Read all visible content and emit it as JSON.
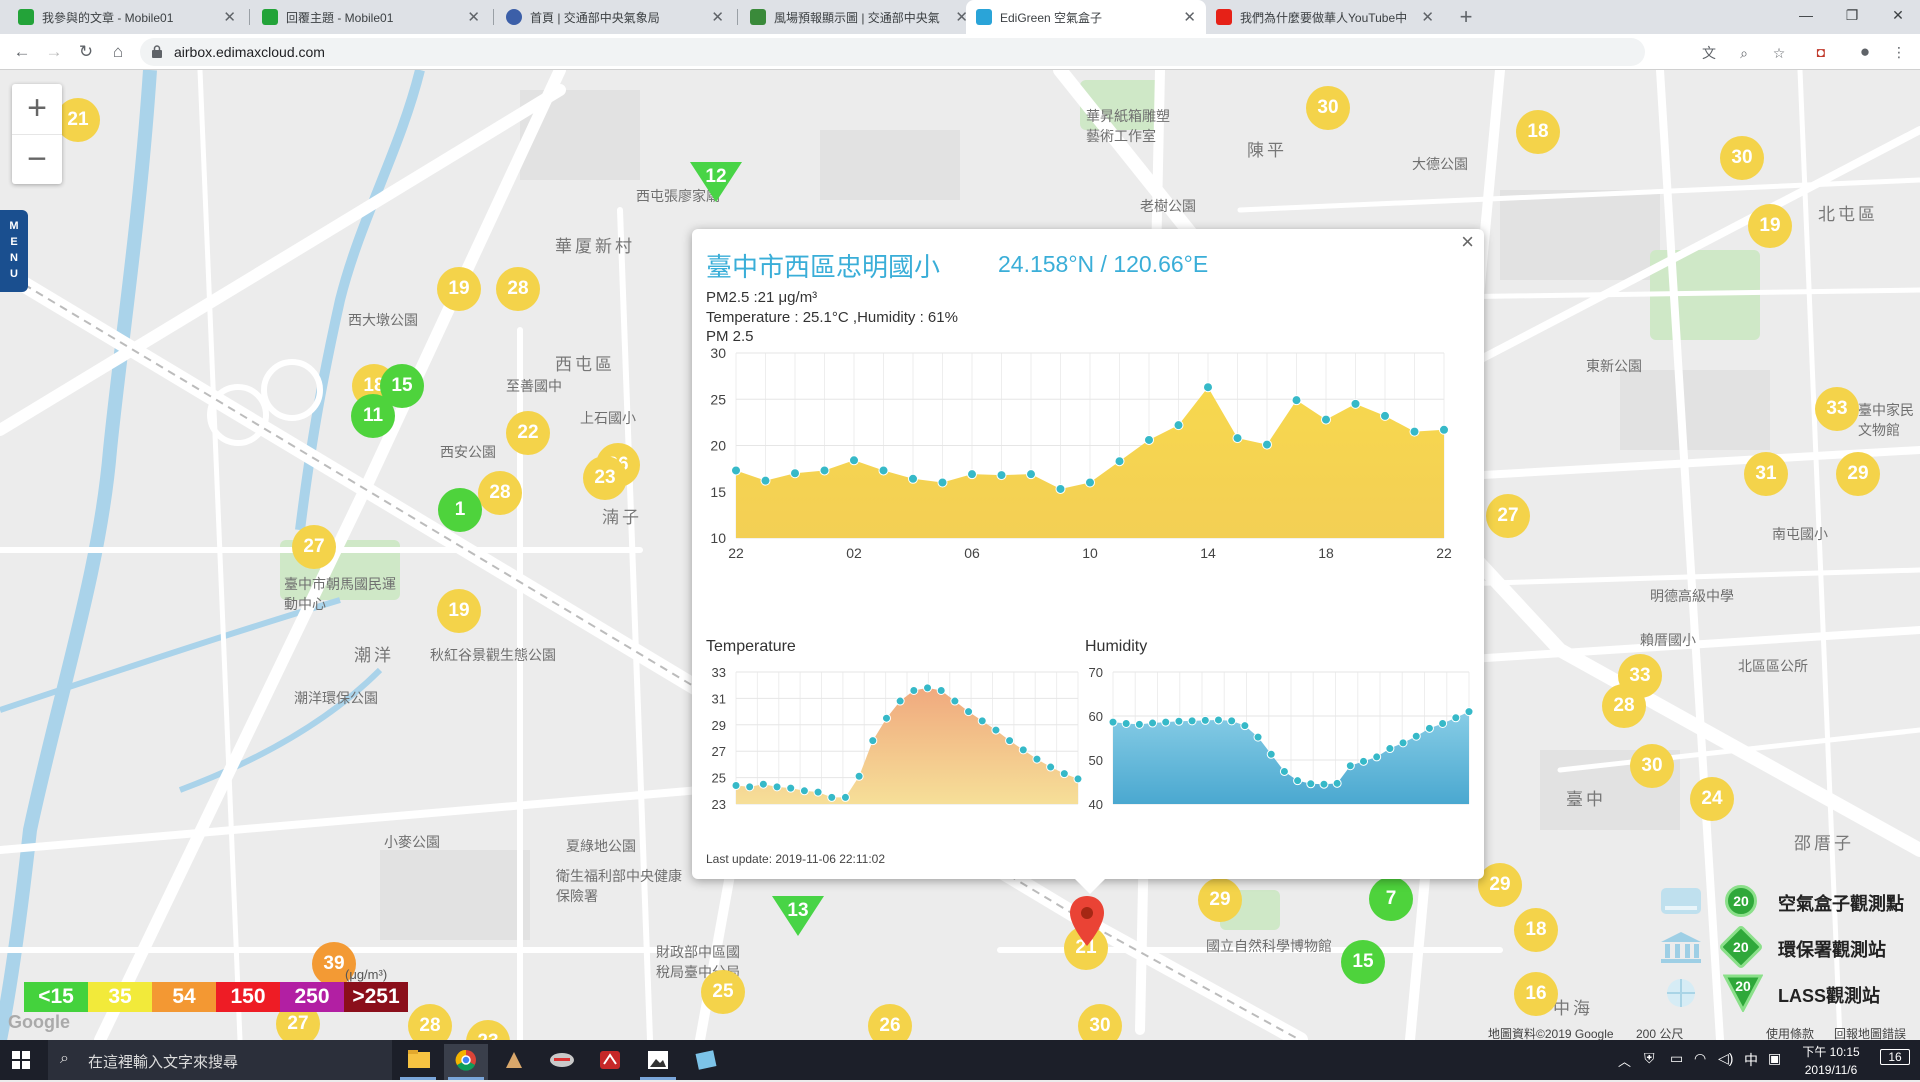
{
  "browser": {
    "tabs": [
      {
        "title": "我參與的文章 - Mobile01",
        "fav_color": "#23a339"
      },
      {
        "title": "回覆主題 - Mobile01",
        "fav_color": "#23a339"
      },
      {
        "title": "首頁 | 交通部中央氣象局",
        "fav_color": "#3c5fa8"
      },
      {
        "title": "風場預報顯示圖 | 交通部中央氣",
        "fav_color": "#3a8a3a"
      },
      {
        "title": "EdiGreen 空氣盒子",
        "fav_color": "#2aa4d8"
      },
      {
        "title": "我們為什麼要做華人YouTube中",
        "fav_color": "#e62117"
      }
    ],
    "url": "airbox.edimaxcloud.com"
  },
  "map": {
    "menu_label": "MENU",
    "zoom_in": "+",
    "zoom_out": "−",
    "labels": {
      "huali": "華厦新村",
      "xitun": "西屯區",
      "chenping": "陳平",
      "beitun": "北屯區",
      "chaoyang": "潮洋",
      "taichung": "臺中",
      "zhuangzi": "湳子",
      "qinhai": "中海",
      "shaodu": "邵厝子",
      "xidapark": "西大墩公園",
      "xian": "西安公園",
      "zhongming_park": "臺中市朝馬國民運動中心",
      "qiuhong": "秋紅谷景觀生態公園",
      "chaoyang_park": "潮洋環保公園",
      "xiaomai": "小麥公園",
      "xiayuan": "夏綠地公園",
      "guoli": "國立自然科學博物館",
      "dongxing": "東新公園",
      "laoshu": "老樹公園",
      "dawei": "大德公園",
      "xitun_zhangliao": "西屯張廖家廟",
      "huayi": "華昇紙箱雕塑藝術工作室",
      "mingde": "明德高級中學",
      "beiqu_park": "北區區公所",
      "mingpu": "南屯國小",
      "zhonghua": "賴厝國小",
      "xinmin": "臺中家民文物館",
      "caizheng": "財政部中區國稅局臺中分局",
      "weisheng": "衛生福利部中央健康保險署",
      "shangshi": "上石國小",
      "zhigong": "至善國中"
    },
    "scale": [
      {
        "label": "<15",
        "color": "#44d23d"
      },
      {
        "label": "35",
        "color": "#f2ea3a"
      },
      {
        "label": "54",
        "color": "#f39833"
      },
      {
        "label": "150",
        "color": "#ee1c25"
      },
      {
        "label": "250",
        "color": "#b21fa3"
      },
      {
        "label": ">251",
        "color": "#8b0f1b"
      }
    ],
    "scale_unit": "(μg/m³)",
    "legend": [
      {
        "value": "20",
        "label": "空氣盒子觀測點"
      },
      {
        "value": "20",
        "label": "環保署觀測站"
      },
      {
        "value": "20",
        "label": "LASS觀測站"
      }
    ],
    "attribution": "地圖資料©2019 Google",
    "scale_bar": "200 公尺",
    "terms": "使用條款",
    "report": "回報地圖錯誤",
    "google": "Google",
    "circle_markers": [
      {
        "v": "21",
        "c": "y"
      },
      {
        "v": "30",
        "c": "y"
      },
      {
        "v": "18",
        "c": "y"
      },
      {
        "v": "30",
        "c": "y"
      },
      {
        "v": "19",
        "c": "y"
      },
      {
        "v": "19",
        "c": "y"
      },
      {
        "v": "28",
        "c": "y"
      },
      {
        "v": "18",
        "c": "y"
      },
      {
        "v": "15",
        "c": "g"
      },
      {
        "v": "11",
        "c": "g"
      },
      {
        "v": "22",
        "c": "y"
      },
      {
        "v": "26",
        "c": "y"
      },
      {
        "v": "23",
        "c": "y"
      },
      {
        "v": "28",
        "c": "y"
      },
      {
        "v": "1",
        "c": "g"
      },
      {
        "v": "27",
        "c": "y"
      },
      {
        "v": "19",
        "c": "y"
      },
      {
        "v": "33",
        "c": "y"
      },
      {
        "v": "31",
        "c": "y"
      },
      {
        "v": "29",
        "c": "y"
      },
      {
        "v": "27",
        "c": "y"
      },
      {
        "v": "33",
        "c": "y"
      },
      {
        "v": "28",
        "c": "y"
      },
      {
        "v": "30",
        "c": "y"
      },
      {
        "v": "24",
        "c": "y"
      },
      {
        "v": "29",
        "c": "y"
      },
      {
        "v": "7",
        "c": "g"
      },
      {
        "v": "29",
        "c": "y"
      },
      {
        "v": "18",
        "c": "y"
      },
      {
        "v": "15",
        "c": "g"
      },
      {
        "v": "16",
        "c": "y"
      },
      {
        "v": "21",
        "c": "y"
      },
      {
        "v": "25",
        "c": "y"
      },
      {
        "v": "26",
        "c": "y"
      },
      {
        "v": "30",
        "c": "y"
      },
      {
        "v": "39",
        "c": "o"
      },
      {
        "v": "27",
        "c": "y"
      },
      {
        "v": "28",
        "c": "y"
      },
      {
        "v": "23",
        "c": "y"
      }
    ],
    "triangle_markers": [
      "12",
      "13"
    ]
  },
  "popup": {
    "title": "臺中市西區忠明國小",
    "coords": "24.158°N / 120.66°E",
    "pm_line": "PM2.5 :21 μg/m³",
    "temp_line": "Temperature : 25.1°C ,Humidity : 61%",
    "chart_label": "PM 2.5",
    "temp_label": "Temperature",
    "hum_label": "Humidity",
    "last_update": "Last update: 2019-11-06 22:11:02",
    "close": "×"
  },
  "chart_data": [
    {
      "type": "area",
      "title": "PM 2.5",
      "ylim": [
        10,
        30
      ],
      "yticks": [
        10,
        15,
        20,
        25,
        30
      ],
      "xticks": [
        "22",
        "02",
        "06",
        "10",
        "14",
        "18",
        "22"
      ],
      "x": [
        0,
        1,
        2,
        3,
        4,
        5,
        6,
        7,
        8,
        9,
        10,
        11,
        12,
        13,
        14,
        15,
        16,
        17,
        18,
        19,
        20,
        21,
        22,
        23,
        24
      ],
      "values": [
        17.3,
        16.2,
        17.0,
        17.3,
        18.4,
        17.3,
        16.4,
        16.0,
        16.9,
        16.8,
        16.9,
        15.3,
        16.0,
        18.3,
        20.6,
        22.2,
        26.3,
        20.8,
        20.1,
        24.9,
        22.8,
        24.5,
        23.2,
        21.5,
        21.7
      ],
      "color": "#f5d45a",
      "grid": true
    },
    {
      "type": "area",
      "title": "Temperature",
      "ylim": [
        23,
        33
      ],
      "yticks": [
        23,
        25,
        27,
        29,
        31,
        33
      ],
      "values": [
        24.4,
        24.3,
        24.5,
        24.3,
        24.2,
        24.0,
        23.9,
        23.5,
        23.5,
        25.1,
        27.8,
        29.5,
        30.8,
        31.6,
        31.8,
        31.6,
        30.8,
        30.0,
        29.3,
        28.6,
        27.8,
        27.1,
        26.4,
        25.8,
        25.3,
        24.9
      ],
      "color": "#f1b778",
      "grid": true
    },
    {
      "type": "area",
      "title": "Humidity",
      "ylim": [
        40,
        70
      ],
      "yticks": [
        40,
        50,
        60,
        70
      ],
      "values": [
        58.6,
        58.3,
        58.1,
        58.4,
        58.6,
        58.8,
        58.9,
        59.0,
        59.1,
        58.9,
        57.8,
        55.2,
        51.3,
        47.4,
        45.3,
        44.6,
        44.5,
        44.7,
        48.7,
        49.7,
        50.7,
        52.6,
        53.9,
        55.4,
        57.2,
        58.3,
        59.6,
        61.0
      ],
      "color": "#60b8dc",
      "grid": true
    }
  ],
  "taskbar": {
    "search_placeholder": "在這裡輸入文字來搜尋",
    "ime": "中",
    "time": "下午 10:15",
    "date": "2019/11/6",
    "notif": "16"
  }
}
